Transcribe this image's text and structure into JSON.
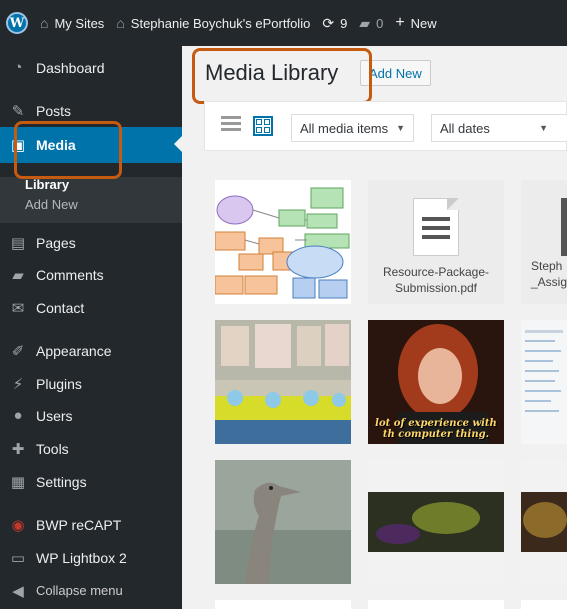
{
  "adminbar": {
    "my_sites": "My Sites",
    "site_name": "Stephanie Boychuk's ePortfolio",
    "updates_count": "9",
    "comments_count": "0",
    "new_label": "New"
  },
  "sidebar": {
    "items": [
      {
        "label": "Dashboard",
        "icon": "dashboard-icon"
      },
      {
        "label": "Posts",
        "icon": "pin-icon"
      },
      {
        "label": "Media",
        "icon": "media-icon"
      },
      {
        "label": "Pages",
        "icon": "pages-icon"
      },
      {
        "label": "Comments",
        "icon": "comments-icon"
      },
      {
        "label": "Contact",
        "icon": "mail-icon"
      },
      {
        "label": "Appearance",
        "icon": "brush-icon"
      },
      {
        "label": "Plugins",
        "icon": "plug-icon"
      },
      {
        "label": "Users",
        "icon": "users-icon"
      },
      {
        "label": "Tools",
        "icon": "wrench-icon"
      },
      {
        "label": "Settings",
        "icon": "settings-icon"
      },
      {
        "label": "BWP reCAPT",
        "icon": "recaptcha-icon"
      },
      {
        "label": "WP Lightbox 2",
        "icon": "lightbox-icon"
      },
      {
        "label": "Collapse menu",
        "icon": "collapse-icon"
      }
    ],
    "submenu": {
      "library": "Library",
      "add_new": "Add New"
    }
  },
  "main": {
    "title": "Media Library",
    "add_new": "Add New",
    "filter_type": "All media items",
    "filter_date": "All dates"
  },
  "media": {
    "doc1_name": "Resource-Package-Submission.pdf",
    "doc2_name": "Steph _Assig",
    "gif_caption": "lot of experience with th computer thing."
  },
  "colors": {
    "admin_bg": "#23282d",
    "active_blue": "#0073aa",
    "annotation": "#c55a11"
  }
}
